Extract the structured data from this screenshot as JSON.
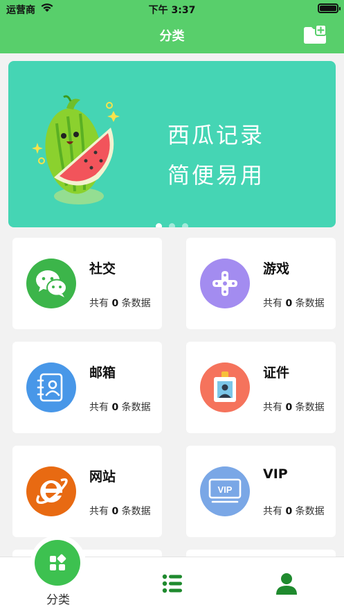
{
  "status_bar": {
    "carrier": "运营商",
    "time": "下午 3:37",
    "battery_level": 1.0
  },
  "nav": {
    "title": "分类",
    "add_icon": "folder-add-icon"
  },
  "banner": {
    "line1": "西瓜记录",
    "line2": "简便易用",
    "page_count": 3,
    "active_page": 0
  },
  "categories": [
    {
      "name": "社交",
      "count_prefix": "共有",
      "count": "0",
      "count_suffix": "条数据",
      "icon": "wechat-icon",
      "color": "#3cb54a"
    },
    {
      "name": "游戏",
      "count_prefix": "共有",
      "count": "0",
      "count_suffix": "条数据",
      "icon": "gamepad-icon",
      "color": "#a38cf0"
    },
    {
      "name": "邮箱",
      "count_prefix": "共有",
      "count": "0",
      "count_suffix": "条数据",
      "icon": "contact-book-icon",
      "color": "#4897e8"
    },
    {
      "name": "证件",
      "count_prefix": "共有",
      "count": "0",
      "count_suffix": "条数据",
      "icon": "id-badge-icon",
      "color": "#f5735c"
    },
    {
      "name": "网站",
      "count_prefix": "共有",
      "count": "0",
      "count_suffix": "条数据",
      "icon": "ie-browser-icon",
      "color": "#e86a12"
    },
    {
      "name": "VIP",
      "count_prefix": "共有",
      "count": "0",
      "count_suffix": "条数据",
      "icon": "vip-card-icon",
      "color": "#7aa7e6"
    }
  ],
  "tabbar": {
    "tabs": [
      {
        "label": "分类",
        "icon": "category-grid-icon",
        "active": true
      },
      {
        "label": "",
        "icon": "list-icon",
        "active": false
      },
      {
        "label": "",
        "icon": "user-icon",
        "active": false
      }
    ],
    "accent": "#3dc150",
    "icon_color": "#1f8a2e"
  }
}
